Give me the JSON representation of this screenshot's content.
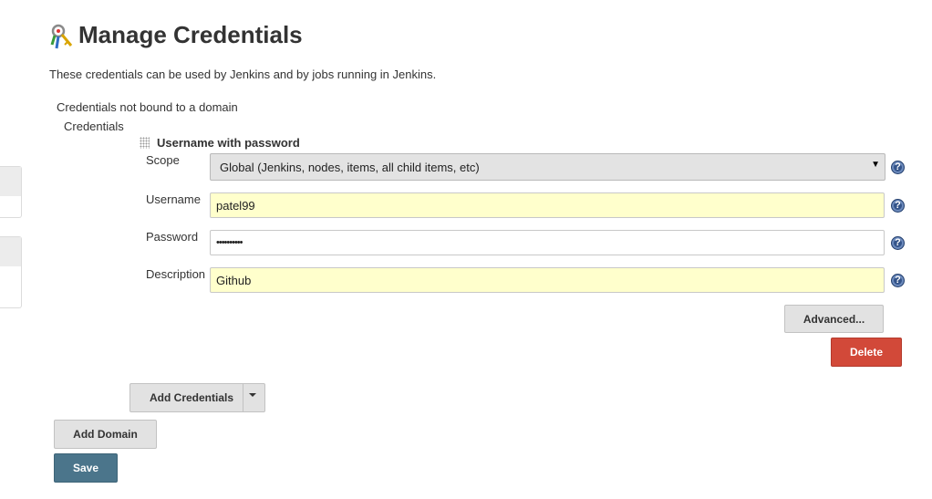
{
  "header": {
    "title": "Manage Credentials",
    "description": "These credentials can be used by Jenkins and by jobs running in Jenkins."
  },
  "domain": {
    "label": "Credentials not bound to a domain",
    "credentials_label": "Credentials"
  },
  "credential": {
    "kind": "Username with password",
    "scope": {
      "label": "Scope",
      "selected": "Global (Jenkins, nodes, items, all child items, etc)"
    },
    "username": {
      "label": "Username",
      "value": "patel99"
    },
    "password": {
      "label": "Password",
      "value": "••••••••••"
    },
    "description": {
      "label": "Description",
      "value": "Github"
    },
    "help_glyph": "?"
  },
  "buttons": {
    "advanced": "Advanced...",
    "delete": "Delete",
    "add_credentials": "Add Credentials",
    "add_domain": "Add Domain",
    "save": "Save"
  },
  "colors": {
    "field_highlight": "#ffffcc",
    "delete": "#d24939",
    "save": "#4b758b",
    "help": "#34548a"
  },
  "icons": {
    "title": "credentials-keys-icon",
    "help": "help-icon",
    "drag": "drag-handle-icon",
    "dropdown": "chevron-down-icon"
  }
}
